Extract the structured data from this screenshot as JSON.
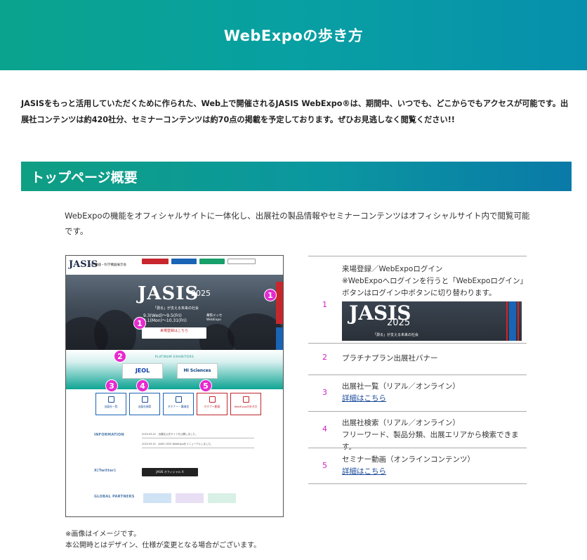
{
  "hero": {
    "title": "WebExpoの歩き方"
  },
  "intro": "JASISをもっと活用していただくために作られた、Web上で開催されるJASIS WebExpo®は、期間中、いつでも、どこからでもアクセスが可能です。出展社コンテンツは約420社分、セミナーコンテンツは約70点の掲載を予定しております。ぜひお見逃しなく閲覧ください!!",
  "section": {
    "title": "トップページ概要",
    "lead": "WebExpoの機能をオフィシャルサイトに一体化し、出展社の製品情報やセミナーコンテンツはオフィシャルサイト内で閲覧可能です。"
  },
  "mock": {
    "logo": "JASIS",
    "org": "分析機器・科学機器展示会",
    "title": "JASIS",
    "year": "2025",
    "subtitle": "「測る」が支える未来の社会",
    "date": "9.3(Wed)〜9.5(Fri)",
    "online": "9.1(Mon)〜10.31(Fri)",
    "venue": "幕張メッセ",
    "venue2": "WebExpo",
    "register": "来場登録はこちら",
    "platinum": "PLATINUM EXHIBITORS",
    "logo1": "JEOL",
    "logo2": "HI Sciences",
    "cards": [
      "出展社一覧",
      "出展社検索",
      "セミナー・講演会",
      "セミナー動画",
      "WebExpoの歩き方"
    ],
    "information": "INFORMATION",
    "info_rows": [
      "2025.09.01　出展社公式サイトを公開しました。",
      "2025.09.01　JASIS 2025 WebExpoをリニューアルしました。"
    ],
    "x_label": "X(Twitter)",
    "x_button": "JASIS オフィシャル X",
    "partners": "GLOBAL PARTNERS",
    "badges": [
      "1",
      "1",
      "2",
      "3",
      "4",
      "5"
    ]
  },
  "notes": [
    "※画像はイメージです。",
    "本公開時とはデザイン、仕様が変更となる場合がございます。"
  ],
  "legend": [
    {
      "num": "1",
      "lines": [
        "来場登録／WebExpoログイン",
        "※WebExpoへログインを行うと「WebExpoログイン」",
        "ボタンはログイン中ボタンに切り替わります。"
      ],
      "link": ""
    },
    {
      "num": "2",
      "lines": [
        "プラチナプラン出展社バナー"
      ],
      "link": ""
    },
    {
      "num": "3",
      "lines": [
        "出展社一覧（リアル／オンライン）"
      ],
      "link": "詳細はこちら"
    },
    {
      "num": "4",
      "lines": [
        "出展社検索（リアル／オンライン）",
        "フリーワード、製品分類、出展エリアから検索できます。"
      ],
      "link": ""
    },
    {
      "num": "5",
      "lines": [
        "セミナー動画（オンラインコンテンツ）"
      ],
      "link": "詳細はこちら"
    }
  ],
  "legend_img": {
    "title": "JASIS",
    "year": "2025",
    "subtitle": "「測る」が支える未来の社会"
  },
  "colors": {
    "accent": "#0aa38d",
    "badge": "#e62ad0",
    "number": "#d21fc1",
    "link": "#1a4a9a"
  }
}
